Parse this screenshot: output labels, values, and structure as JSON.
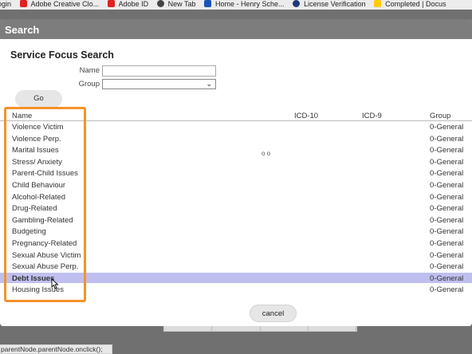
{
  "bookmarks": [
    {
      "label": "ogin",
      "icon": "none",
      "color": "#ececec"
    },
    {
      "label": "Adobe Creative Clo...",
      "icon": "adobe-icon",
      "color": "#e0201f"
    },
    {
      "label": "Adobe ID",
      "icon": "adobe-icon",
      "color": "#e0201f"
    },
    {
      "label": "New Tab",
      "icon": "chrome-icon",
      "color": "#444444"
    },
    {
      "label": "Home - Henry Sche...",
      "icon": "henry-schein-icon",
      "color": "#1a54b8"
    },
    {
      "label": "License Verification",
      "icon": "license-icon",
      "color": "#1e3a7a"
    },
    {
      "label": "Completed | Docus",
      "icon": "docusign-icon",
      "color": "#ffcc00"
    }
  ],
  "dialog": {
    "title": "Search",
    "heading": "Service Focus Search",
    "name_label": "Name",
    "name_value": "",
    "group_label": "Group",
    "group_value": "",
    "go_label": "Go",
    "cancel_label": "cancel"
  },
  "table": {
    "headers": {
      "name": "Name",
      "icd10": "ICD-10",
      "icd9": "ICD-9",
      "group": "Group"
    },
    "rows": [
      {
        "name": "Violence Victim",
        "icd10": "",
        "icd9": "",
        "group": "0-General"
      },
      {
        "name": "Violence Perp.",
        "icd10": "",
        "icd9": "",
        "group": "0-General"
      },
      {
        "name": "Marital Issues",
        "icd10": "",
        "icd9": "",
        "group": "0-General"
      },
      {
        "name": "Stress/ Anxiety",
        "icd10": "",
        "icd9": "",
        "group": "0-General"
      },
      {
        "name": "Parent-Child Issues",
        "icd10": "",
        "icd9": "",
        "group": "0-General"
      },
      {
        "name": "Child Behaviour",
        "icd10": "",
        "icd9": "",
        "group": "0-General"
      },
      {
        "name": "Alcohol-Related",
        "icd10": "",
        "icd9": "",
        "group": "0-General"
      },
      {
        "name": "Drug-Related",
        "icd10": "",
        "icd9": "",
        "group": "0-General"
      },
      {
        "name": "Gambling-Related",
        "icd10": "",
        "icd9": "",
        "group": "0-General"
      },
      {
        "name": "Budgeting",
        "icd10": "",
        "icd9": "",
        "group": "0-General"
      },
      {
        "name": "Pregnancy-Related",
        "icd10": "",
        "icd9": "",
        "group": "0-General"
      },
      {
        "name": "Sexual Abuse Victim",
        "icd10": "",
        "icd9": "",
        "group": "0-General"
      },
      {
        "name": "Sexual Abuse Perp.",
        "icd10": "",
        "icd9": "",
        "group": "0-General"
      },
      {
        "name": "Debt Issues",
        "icd10": "",
        "icd9": "",
        "group": "0-General",
        "selected": true
      },
      {
        "name": "Housing Issues",
        "icd10": "",
        "icd9": "",
        "group": "0-General"
      }
    ]
  },
  "loading_indicator": "o o",
  "status_bar": "parentNode.parentNode.onclick();",
  "colors": {
    "selected_row": "#bfbfef",
    "highlight_border": "#f4922b",
    "titlebar": "#7d7d7d"
  }
}
